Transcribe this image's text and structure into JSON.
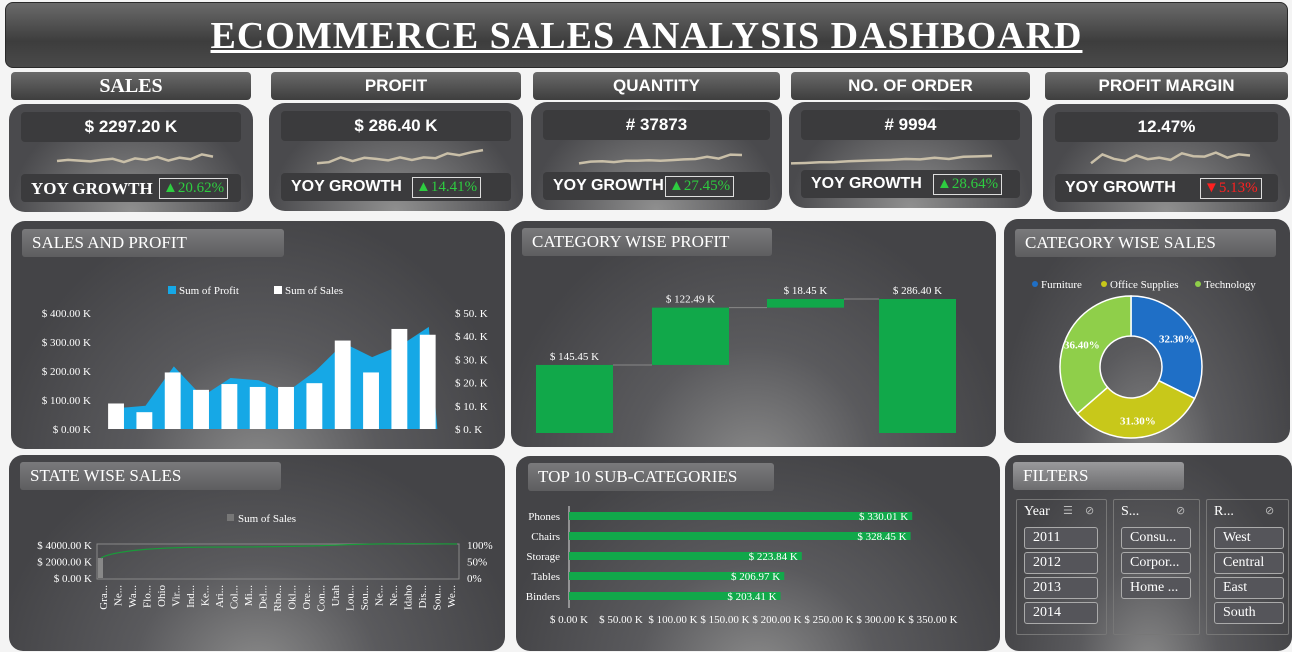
{
  "title": "ECOMMERCE SALES ANALYSIS DASHBOARD",
  "kpis": [
    {
      "header": "SALES",
      "value": "$ 2297.20 K",
      "yoy_label": "YOY GROWTH",
      "growth": "▲20.62%",
      "trend": "up",
      "spark": [
        0.5,
        0.55,
        0.52,
        0.48,
        0.55,
        0.6,
        0.45,
        0.62,
        0.55,
        0.68,
        0.52,
        0.65,
        0.58,
        0.8,
        0.7
      ]
    },
    {
      "header": "PROFIT",
      "value": "$ 286.40 K",
      "yoy_label": "YOY GROWTH",
      "growth": "▲14.41%",
      "trend": "up",
      "spark": [
        0.35,
        0.4,
        0.62,
        0.45,
        0.6,
        0.55,
        0.48,
        0.62,
        0.5,
        0.62,
        0.58,
        0.8,
        0.72,
        0.85,
        0.95
      ]
    },
    {
      "header": "QUANTITY",
      "value": "# 37873",
      "yoy_label": "YOY GROWTH",
      "growth": "▲27.45%",
      "trend": "up",
      "spark": [
        0.3,
        0.38,
        0.4,
        0.36,
        0.42,
        0.42,
        0.44,
        0.42,
        0.45,
        0.48,
        0.5,
        0.6,
        0.52,
        0.7,
        0.68
      ]
    },
    {
      "header": "NO. OF ORDER",
      "value": "# 9994",
      "yoy_label": "YOY GROWTH",
      "growth": "▲28.64%",
      "trend": "up",
      "spark": [
        0.3,
        0.32,
        0.35,
        0.36,
        0.4,
        0.42,
        0.44,
        0.46,
        0.5,
        0.48,
        0.56,
        0.5,
        0.6,
        0.62,
        0.64
      ]
    },
    {
      "header": "PROFIT MARGIN",
      "value": "12.47%",
      "yoy_label": "YOY GROWTH",
      "growth": "▼5.13%",
      "trend": "down",
      "spark": [
        0.4,
        0.8,
        0.6,
        0.5,
        0.75,
        0.58,
        0.65,
        0.55,
        0.85,
        0.72,
        0.7,
        0.88,
        0.65,
        0.8,
        0.75
      ]
    }
  ],
  "sales_profit": {
    "title": "SALES AND PROFIT",
    "legend_profit": "Sum of Profit",
    "legend_sales": "Sum of Sales",
    "left_ticks": [
      "$ 400.00 K",
      "$ 300.00 K",
      "$ 200.00 K",
      "$ 100.00 K",
      "$ 0.00 K"
    ],
    "right_ticks": [
      "$ 50. K",
      "$ 40. K",
      "$ 30. K",
      "$ 20. K",
      "$ 10. K",
      "$ 0. K"
    ],
    "chart_data": {
      "type": "bar",
      "sales": [
        88,
        58,
        195,
        135,
        155,
        145,
        145,
        158,
        305,
        195,
        345,
        325
      ],
      "profit": [
        9,
        10,
        27,
        14,
        22,
        21,
        16,
        25,
        37,
        31,
        36,
        44
      ]
    }
  },
  "category_profit": {
    "title": "CATEGORY WISE PROFIT",
    "chart_data": {
      "type": "bar",
      "labels": [
        "$ 145.45 K",
        "$ 122.49 K",
        "$ 18.45 K",
        "$ 286.40 K"
      ],
      "values": [
        145.45,
        122.49,
        18.45,
        286.4
      ]
    }
  },
  "category_sales": {
    "title": "CATEGORY WISE SALES",
    "chart_data": {
      "type": "pie",
      "slices": [
        {
          "name": "Furniture",
          "value": 32.3,
          "label": "32.30%",
          "color": "#1f6fc6"
        },
        {
          "name": "Office Supplies",
          "value": 31.3,
          "label": "31.30%",
          "color": "#c8c81a"
        },
        {
          "name": "Technology",
          "value": 36.4,
          "label": "36.40%",
          "color": "#8fcf4a"
        }
      ]
    }
  },
  "state_sales": {
    "title": "STATE WISE SALES",
    "legend": "Sum of Sales",
    "left_ticks": [
      "$ 4000.00 K",
      "$ 2000.00 K",
      "$ 0.00 K"
    ],
    "right_ticks": [
      "100%",
      "50%",
      "0%"
    ],
    "states": [
      "Gra...",
      "Ne...",
      "Wa...",
      "Flo...",
      "Ohio",
      "Vir...",
      "Ind...",
      "Ke...",
      "Ari...",
      "Col...",
      "Mi...",
      "Del...",
      "Rho...",
      "Okl...",
      "Ore...",
      "Con...",
      "Utah",
      "Lou...",
      "Sou...",
      "Ne...",
      "Ne...",
      "Idaho",
      "Dis...",
      "Sou...",
      "We..."
    ]
  },
  "top_sub": {
    "title": "TOP 10 SUB-CATEGORIES",
    "x_ticks": [
      "$ 0.00 K",
      "$ 50.00 K",
      "$ 100.00 K",
      "$ 150.00 K",
      "$ 200.00 K",
      "$ 250.00 K",
      "$ 300.00 K",
      "$ 350.00 K"
    ],
    "chart_data": {
      "type": "bar",
      "categories": [
        "Phones",
        "Chairs",
        "Storage",
        "Tables",
        "Binders"
      ],
      "values": [
        330.01,
        328.45,
        223.84,
        206.97,
        203.41
      ],
      "labels": [
        "$ 330.01 K",
        "$ 328.45 K",
        "$ 223.84 K",
        "$ 206.97 K",
        "$ 203.41 K"
      ]
    }
  },
  "filters": {
    "title": "FILTERS",
    "year": {
      "header": "Year",
      "items": [
        "2011",
        "2012",
        "2013",
        "2014"
      ]
    },
    "segment": {
      "header": "S...",
      "items": [
        "Consu...",
        "Corpor...",
        "Home ..."
      ]
    },
    "region": {
      "header": "R...",
      "items": [
        "West",
        "Central",
        "East",
        "South"
      ]
    }
  }
}
